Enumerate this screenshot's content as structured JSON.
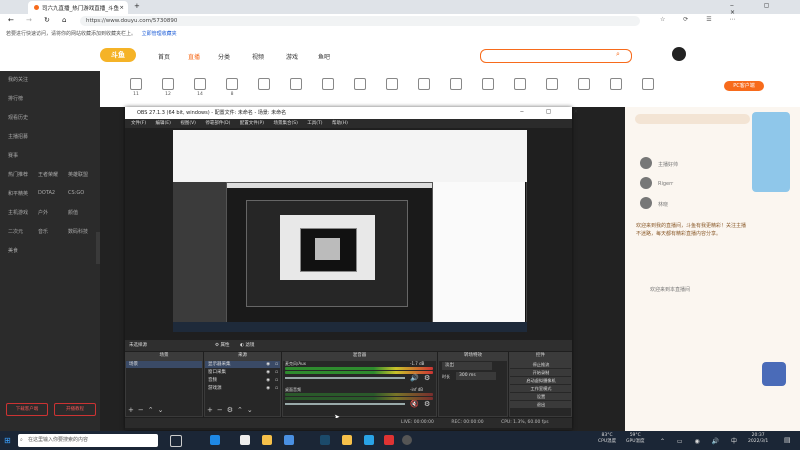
{
  "browser": {
    "tab_title": "司六九直播_热门游戏直播_斗鱼",
    "url": "https://www.douyu.com/5730890",
    "favorites_text": "若要进行快速访问，请将你的网站收藏添加到收藏夹栏上。",
    "favorites_link": "立即管理收藏夹"
  },
  "site": {
    "logo": "斗鱼",
    "nav": [
      "首页",
      "直播",
      "分类",
      "视频",
      "游戏",
      "鱼吧"
    ],
    "categories": [
      "11",
      "12",
      "14",
      "8",
      "",
      "",
      "",
      "",
      "",
      "",
      "",
      "",
      "",
      "",
      "",
      "",
      ""
    ],
    "pc_button": "PC客户端"
  },
  "sidebar": {
    "items": [
      "我的关注",
      "排行榜",
      "观看历史",
      "主播招募",
      "赛事",
      "热门推荐",
      "王者荣耀",
      "英雄联盟",
      "和平精英",
      "DOTA2",
      "CS:GO",
      "主机游戏",
      "户外",
      "颜值",
      "二次元",
      "音乐",
      "数码科技",
      "美食"
    ],
    "btn_left": "下载客户端",
    "btn_right": "开播教程"
  },
  "rightpanel": {
    "chat": [
      "主播好帅",
      "Rigerr",
      "林晓",
      "欢迎来到我的直播间，斗鱼有我更精彩！关注主播不迷路，每天都有精彩直播内容分享。",
      "欢迎来到本直播间"
    ]
  },
  "obs": {
    "title": "OBS 27.1.3 (64 bit, windows) - 配置文件: 未命名 - 场景: 未命名",
    "menu": [
      "文件(F)",
      "编辑(E)",
      "视图(V)",
      "停靠部件(D)",
      "配置文件(P)",
      "场景集合(S)",
      "工具(T)",
      "帮助(H)"
    ],
    "source_label": "未选择源",
    "props_button": "属性",
    "filter_button": "滤镜",
    "docks": {
      "scenes": "场景",
      "sources": "来源",
      "mixer": "混音器",
      "transitions": "转场特效",
      "controls": "控件"
    },
    "scenes": [
      "场景"
    ],
    "sources": [
      "显示器采集",
      "窗口采集",
      "音频",
      "游戏源"
    ],
    "mixer": [
      {
        "name": "麦克风/Aux",
        "db": "-1.7 dB"
      },
      {
        "name": "桌面音频",
        "db": "-inf dB"
      }
    ],
    "transition": {
      "type": "淡出",
      "duration_label": "时长",
      "duration": "300 ms"
    },
    "controls": [
      "停止推流",
      "开始录制",
      "启动虚拟摄像机",
      "工作室模式",
      "设置",
      "退出"
    ],
    "status": {
      "live": "LIVE: 00:00:00",
      "rec": "REC: 00:00:00",
      "cpu": "CPU: 1.3%, 60.00 fps"
    }
  },
  "taskbar": {
    "search_placeholder": "在这里输入你要搜索的内容",
    "temp1": "83°C",
    "temp1_label": "CPU温度",
    "temp2": "59°C",
    "temp2_label": "GPU温度",
    "time": "20:37",
    "date": "2022/3/1"
  }
}
